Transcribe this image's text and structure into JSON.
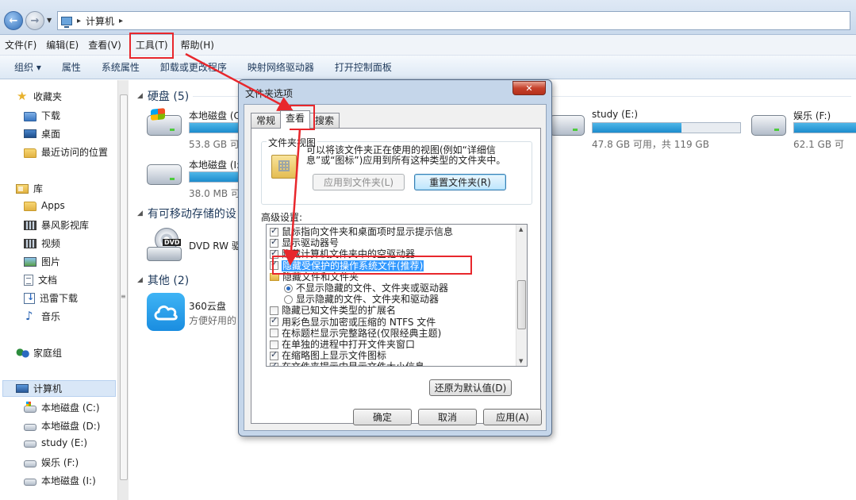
{
  "address": {
    "path": "计算机"
  },
  "menu": [
    "文件(F)",
    "编辑(E)",
    "查看(V)",
    "工具(T)",
    "帮助(H)"
  ],
  "toolbar": [
    "组织 ▾",
    "属性",
    "系统属性",
    "卸载或更改程序",
    "映射网络驱动器",
    "打开控制面板"
  ],
  "nav": {
    "favorites": "收藏夹",
    "downloads": "下载",
    "desktop": "桌面",
    "recent": "最近访问的位置",
    "libraries": "库",
    "apps": "Apps",
    "baofeng": "暴风影视库",
    "videos": "视频",
    "pictures": "图片",
    "documents": "文档",
    "xunlei": "迅雷下载",
    "music": "音乐",
    "homegroup": "家庭组",
    "computer": "计算机",
    "drive_c": "本地磁盘 (C:)",
    "drive_d": "本地磁盘 (D:)",
    "drive_e": "study (E:)",
    "drive_f": "娱乐 (F:)",
    "drive_i": "本地磁盘 (I:)"
  },
  "content": {
    "hdd_group": "硬盘 (5)",
    "removable_group": "有可移动存储的设",
    "other_group": "其他 (2)",
    "drives": [
      {
        "name": "本地磁盘 (C",
        "info": "53.8 GB 可",
        "used": 0.55
      },
      {
        "name": "本地磁盘 (I:",
        "info": "38.0 MB 可",
        "used": 0.94
      },
      {
        "name": "study (E:)",
        "info": "47.8 GB 可用，共 119 GB",
        "used": 0.6
      },
      {
        "name": "娱乐 (F:)",
        "info": "62.1 GB 可",
        "used": 0.5
      }
    ],
    "dvd": "DVD RW 驱",
    "cloud_name": "360云盘",
    "cloud_desc": "方便好用的"
  },
  "dialog": {
    "title": "文件夹选项",
    "close": "✕",
    "tabs": [
      "常规",
      "查看",
      "搜索"
    ],
    "folder_views_legend": "文件夹视图",
    "folder_views_desc": "可以将该文件夹正在使用的视图(例如“详细信息”或“图标”)应用到所有这种类型的文件夹中。",
    "apply_to_folders": "应用到文件夹(L)",
    "reset_folders": "重置文件夹(R)",
    "advanced_label": "高级设置:",
    "advanced": [
      {
        "kind": "check",
        "checked": true,
        "label": "鼠标指向文件夹和桌面项时显示提示信息"
      },
      {
        "kind": "check",
        "checked": true,
        "label": "显示驱动器号"
      },
      {
        "kind": "check",
        "checked": true,
        "label": "隐藏计算机文件夹中的空驱动器"
      },
      {
        "kind": "check",
        "checked": true,
        "label": "隐藏受保护的操作系统文件(推荐)"
      },
      {
        "kind": "folder",
        "label": "隐藏文件和文件夹"
      },
      {
        "kind": "radio",
        "checked": true,
        "label": "不显示隐藏的文件、文件夹或驱动器"
      },
      {
        "kind": "radio",
        "checked": false,
        "label": "显示隐藏的文件、文件夹和驱动器"
      },
      {
        "kind": "check",
        "checked": false,
        "label": "隐藏已知文件类型的扩展名"
      },
      {
        "kind": "check",
        "checked": true,
        "label": "用彩色显示加密或压缩的 NTFS 文件"
      },
      {
        "kind": "check",
        "checked": false,
        "label": "在标题栏显示完整路径(仅限经典主题)"
      },
      {
        "kind": "check",
        "checked": false,
        "label": "在单独的进程中打开文件夹窗口"
      },
      {
        "kind": "check",
        "checked": true,
        "label": "在缩略图上显示文件图标"
      },
      {
        "kind": "check",
        "checked": true,
        "label": "在文件夹提示中显示文件大小信息"
      }
    ],
    "restore_defaults": "还原为默认值(D)",
    "ok": "确定",
    "cancel": "取消",
    "apply": "应用(A)"
  },
  "colors": {
    "annotation": "#e8272c",
    "drive_fill": "#1d8ccd",
    "selection": "#3399ff"
  }
}
